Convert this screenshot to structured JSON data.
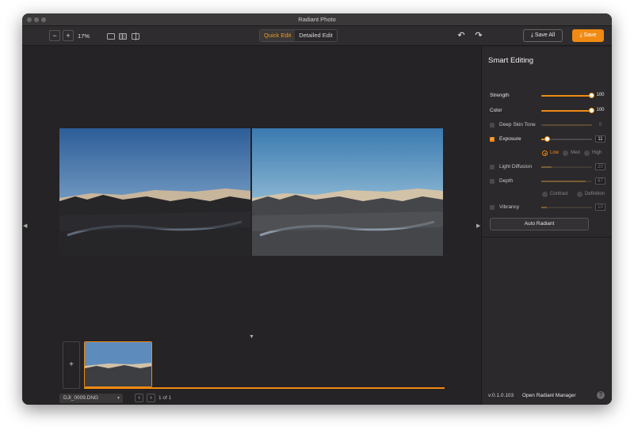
{
  "window": {
    "title": "Radiant Photo"
  },
  "toolbar": {
    "zoom_out": "−",
    "zoom_in": "+",
    "zoom_level": "17%",
    "tabs": [
      "Quick Edit",
      "Detailed Edit"
    ],
    "active_tab": "Quick Edit",
    "undo_icon": "undo-icon",
    "redo_icon": "redo-icon",
    "save_all": "Save All",
    "save": "Save"
  },
  "panel": {
    "title": "Smart Editing",
    "strength": {
      "label": "Strength",
      "value": "100",
      "level": 1.0
    },
    "color": {
      "label": "Color",
      "value": "100",
      "level": 1.0
    },
    "deep_skin_tone": {
      "label": "Deep Skin Tone",
      "value": "0",
      "checked": false
    },
    "exposure": {
      "label": "Exposure",
      "value": "11",
      "checked": true,
      "level": 0.11
    },
    "exposure_levels": [
      "Low",
      "Med",
      "High"
    ],
    "exposure_selected": "Low",
    "light_diffusion": {
      "label": "Light Diffusion",
      "value": "20",
      "checked": false
    },
    "depth": {
      "label": "Depth",
      "value": "87",
      "checked": false
    },
    "depth_options": [
      "Contrast",
      "Definition"
    ],
    "vibrancy": {
      "label": "Vibrancy",
      "value": "10",
      "checked": false
    },
    "auto_radiant": "Auto Radiant",
    "version": "v:0.1.0.103",
    "open_manager": "Open Radiant Manager",
    "help": "?"
  },
  "filmstrip": {
    "add": "+",
    "filename": "DJI_0009.DNG",
    "prev": "‹",
    "next": "›",
    "page": "1 of 1"
  },
  "colors": {
    "accent": "#f08a12",
    "background": "#252325",
    "panel": "#2b292b"
  }
}
